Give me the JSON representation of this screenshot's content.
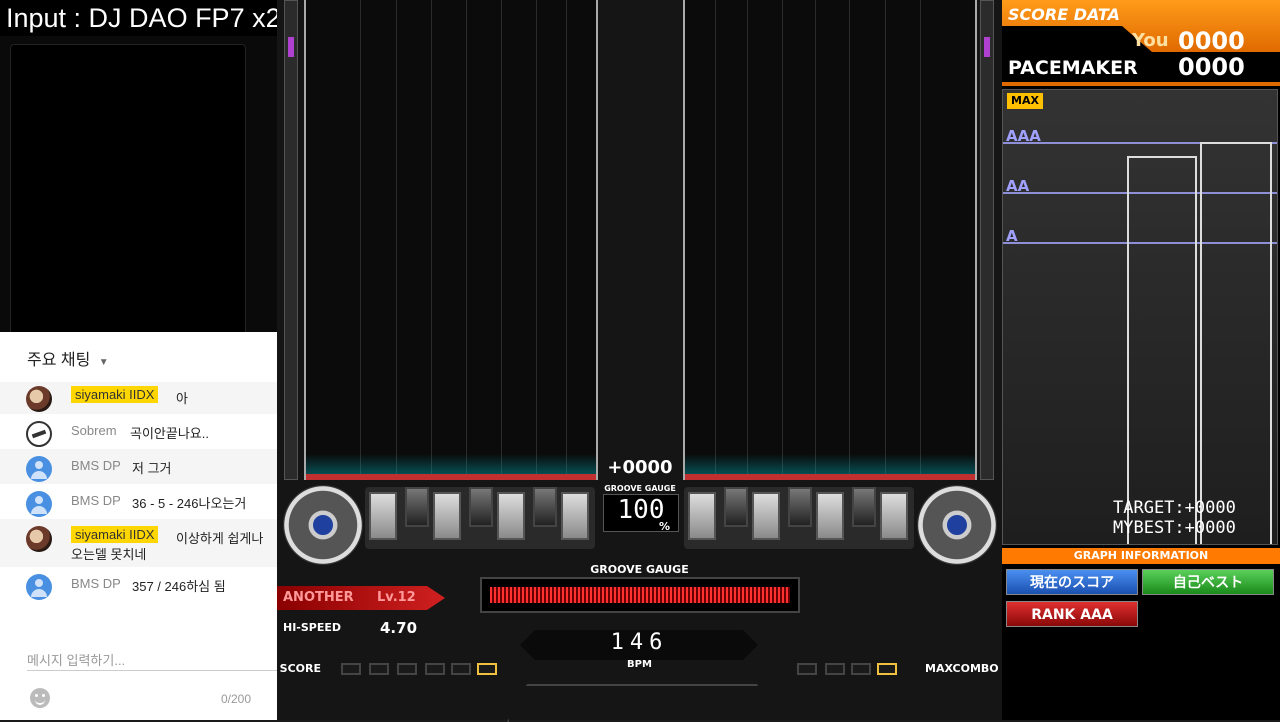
{
  "input_label": "Input : DJ DAO FP7 x2",
  "chat": {
    "title": "주요 채팅",
    "messages": [
      {
        "author": "siyamaki IIDX",
        "text": "아",
        "avatar": "anime-avatar",
        "owner": true
      },
      {
        "author": "Sobrem",
        "text": "곡이안끝나요..",
        "avatar": "logo-avatar",
        "owner": false
      },
      {
        "author": "BMS DP",
        "text": "저 그거",
        "avatar": "default-avatar",
        "owner": false
      },
      {
        "author": "BMS DP",
        "text": "36 - 5 - 246나오는거",
        "avatar": "default-avatar",
        "owner": false
      },
      {
        "author": "siyamaki IIDX",
        "text": "이상하게 쉽게나",
        "text2": "오는델 못치네",
        "avatar": "anime-avatar",
        "owner": true
      },
      {
        "author": "BMS DP",
        "text": "357 / 246하심 됨",
        "avatar": "default-avatar",
        "owner": false
      }
    ],
    "input_placeholder": "메시지 입력하기...",
    "char_count": "0/200"
  },
  "game": {
    "score_center": "+0000",
    "groove_gauge_small": "GROOVE GAUGE",
    "groove_gauge_pct": "100",
    "pct_sign": "%",
    "difficulty": "ANOTHER",
    "level": "Lv.12",
    "hispeed_label": "HI-SPEED",
    "hispeed_value": "4.70",
    "groove_gauge_title": "GROOVE GAUGE",
    "gauge_fill": 1.0,
    "bpm_value": "146",
    "bpm_label": "BPM",
    "score_label": "SCORE",
    "maxcombo_label": "MAXCOMBO"
  },
  "score_panel": {
    "title": "SCORE DATA",
    "you_label": "You",
    "you_value": "0000",
    "pacemaker_label": "PACEMAKER",
    "pacemaker_value": "0000",
    "max_label": "MAX",
    "ranks": [
      "AAA",
      "AA",
      "A"
    ],
    "target": "TARGET:+0000",
    "mybest": "MYBEST:+0000",
    "graph_info": "GRAPH INFORMATION",
    "btn_current": "現在のスコア",
    "btn_best": "自己ベスト",
    "btn_rank": "RANK AAA",
    "colors": {
      "accent": "#ff7a00",
      "current": "#2a6fd6",
      "best": "#2ea82e",
      "rank": "#c01818"
    }
  }
}
